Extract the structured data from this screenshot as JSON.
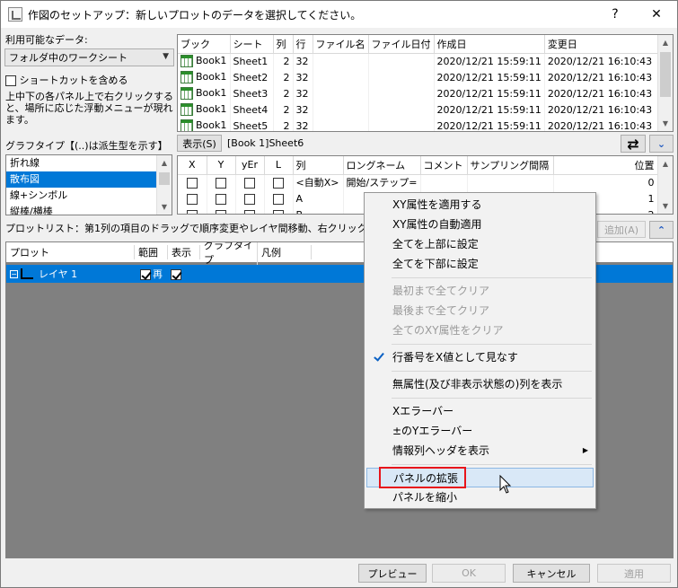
{
  "window": {
    "title": "作図のセットアップ：新しいプロットのデータを選択してください。",
    "help_label": "?",
    "close_label": "✕"
  },
  "left": {
    "available_data_label": "利用可能なデータ:",
    "source_select": "フォルダ中のワークシート",
    "include_shortcuts_label": "ショートカットを含める",
    "hint_text": "上中下の各パネル上で右クリックすると、場所に応じた浮動メニューが現れます。",
    "graph_type_label": "グラフタイプ【(..)は派生型を示す】",
    "graph_types": [
      "折れ線",
      "散布図",
      "線+シンボル",
      "縦棒/横棒"
    ]
  },
  "book_table": {
    "headers": [
      "ブック",
      "シート",
      "列",
      "行",
      "ファイル名",
      "ファイル日付",
      "作成日",
      "変更日"
    ],
    "rows": [
      [
        "Book1",
        "Sheet1",
        "2",
        "32",
        "",
        "",
        "2020/12/21 15:59:11",
        "2020/12/21 16:10:43"
      ],
      [
        "Book1",
        "Sheet2",
        "2",
        "32",
        "",
        "",
        "2020/12/21 15:59:11",
        "2020/12/21 16:10:43"
      ],
      [
        "Book1",
        "Sheet3",
        "2",
        "32",
        "",
        "",
        "2020/12/21 15:59:11",
        "2020/12/21 16:10:43"
      ],
      [
        "Book1",
        "Sheet4",
        "2",
        "32",
        "",
        "",
        "2020/12/21 15:59:11",
        "2020/12/21 16:10:43"
      ],
      [
        "Book1",
        "Sheet5",
        "2",
        "32",
        "",
        "",
        "2020/12/21 15:59:11",
        "2020/12/21 16:10:43"
      ]
    ]
  },
  "middle": {
    "show_button": "表示(S)",
    "sheet_ref": "[Book 1]Sheet6",
    "swap_icon": "⇄",
    "collapse_icon": "⌄"
  },
  "column_table": {
    "headers": [
      "X",
      "Y",
      "yEr",
      "L",
      "列",
      "ロングネーム",
      "コメント",
      "サンプリング間隔",
      "位置"
    ],
    "rows": [
      [
        "",
        "",
        "",
        "",
        "<自動X>",
        "開始/ステップ=",
        "",
        "",
        "0"
      ],
      [
        "",
        "",
        "",
        "",
        "A",
        "",
        "",
        "",
        "1"
      ],
      [
        "",
        "",
        "",
        "",
        "B",
        "",
        "",
        "",
        "2"
      ]
    ]
  },
  "plotlist": {
    "label": "プロットリスト：第1列の項目のドラッグで順序変更やレイヤ間移動、右クリックで",
    "add_button": "追加(A)",
    "expand_icon": "⌃",
    "headers": [
      "プロット",
      "範囲",
      "表示",
      "グラフタイプ",
      "凡例"
    ],
    "layer_row": {
      "name": "レイヤ 1",
      "range_text": "再"
    }
  },
  "context_menu": {
    "items": [
      {
        "label": "XY属性を適用する",
        "state": "enabled"
      },
      {
        "label": "XY属性の自動適用",
        "state": "enabled"
      },
      {
        "label": "全てを上部に設定",
        "state": "enabled"
      },
      {
        "label": "全てを下部に設定",
        "state": "enabled"
      },
      {
        "label": "最初まで全てクリア",
        "state": "disabled"
      },
      {
        "label": "最後まで全てクリア",
        "state": "disabled"
      },
      {
        "label": "全てのXY属性をクリア",
        "state": "disabled"
      },
      {
        "label": "行番号をX値として見なす",
        "state": "checked"
      },
      {
        "label": "無属性(及び非表示状態の)列を表示",
        "state": "enabled"
      },
      {
        "label": "Xエラーバー",
        "state": "enabled"
      },
      {
        "label": "±のYエラーバー",
        "state": "enabled"
      },
      {
        "label": "情報列ヘッダを表示",
        "state": "submenu"
      },
      {
        "label": "パネルの拡張",
        "state": "hover"
      },
      {
        "label": "パネルを縮小",
        "state": "enabled"
      }
    ]
  },
  "footer": {
    "preview": "プレビュー",
    "ok": "OK",
    "cancel": "キャンセル",
    "apply": "適用"
  }
}
